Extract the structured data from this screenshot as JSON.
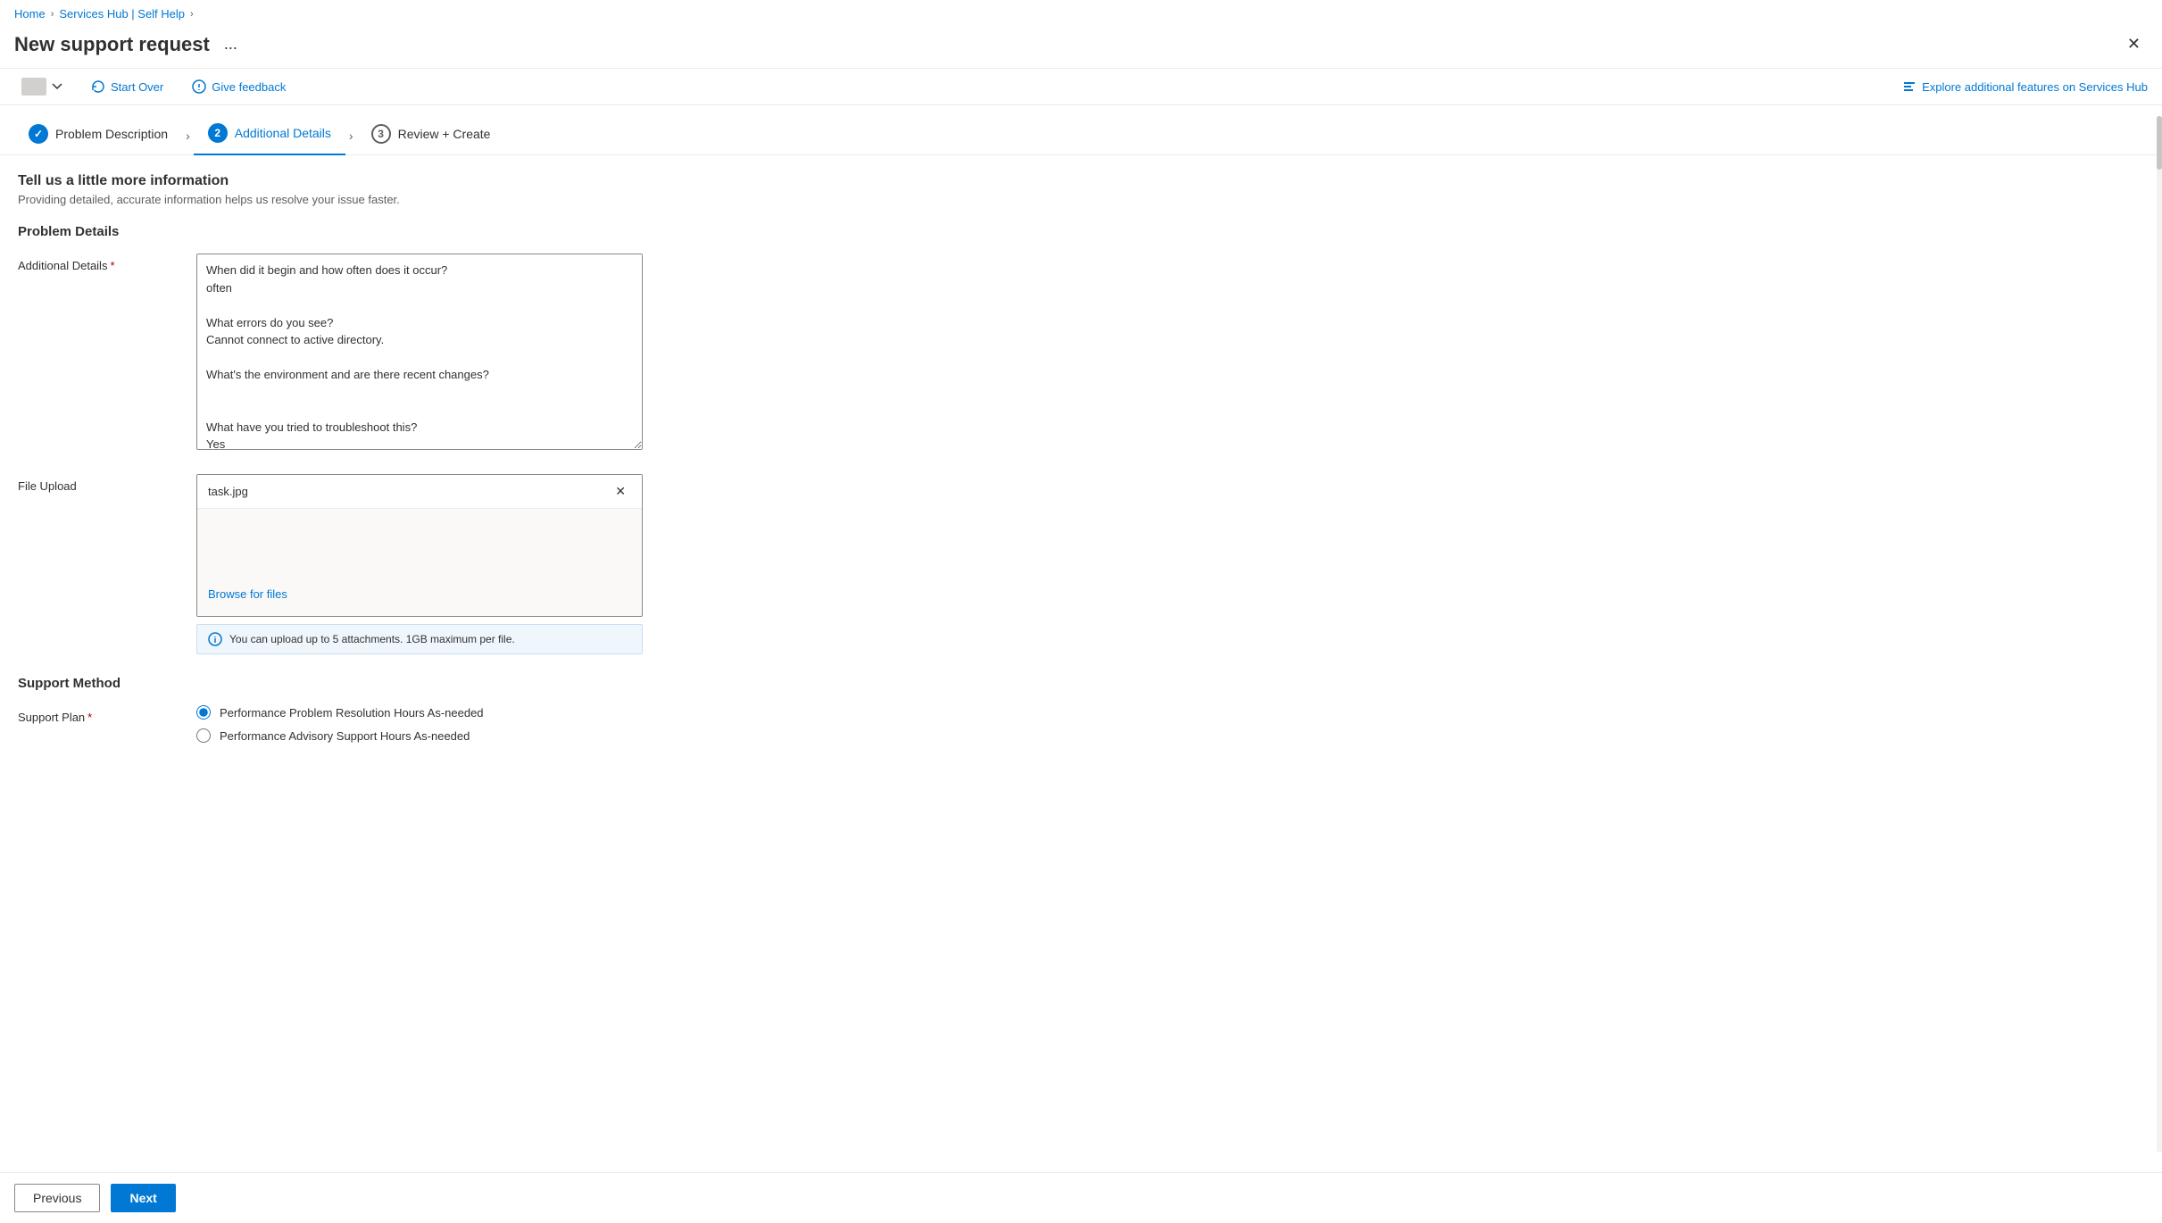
{
  "breadcrumb": {
    "home": "Home",
    "hub": "Services Hub | Self Help"
  },
  "title": "New support request",
  "ellipsis": "...",
  "toolbar": {
    "dropdown_label": "",
    "start_over": "Start Over",
    "give_feedback": "Give feedback",
    "explore": "Explore additional features on Services Hub"
  },
  "steps": [
    {
      "id": 1,
      "label": "Problem Description",
      "state": "completed"
    },
    {
      "id": 2,
      "label": "Additional Details",
      "state": "active"
    },
    {
      "id": 3,
      "label": "Review + Create",
      "state": "pending"
    }
  ],
  "section": {
    "title": "Tell us a little more information",
    "subtitle": "Providing detailed, accurate information helps us resolve your issue faster."
  },
  "problem_details": {
    "title": "Problem Details",
    "additional_details_label": "Additional Details",
    "textarea_content": "When did it begin and how often does it occur?\noften\n\nWhat errors do you see?\nCannot connect to active directory.\n\nWhat's the environment and are there recent changes?\n\n\nWhat have you tried to troubleshoot this?\nYes",
    "file_upload_label": "File Upload",
    "file_name": "task.jpg",
    "browse_label": "Browse for files",
    "upload_info": "You can upload up to 5 attachments. 1GB maximum per file."
  },
  "support_method": {
    "section_title": "Support Method",
    "plan_label": "Support Plan",
    "options": [
      {
        "id": "opt1",
        "label": "Performance Problem Resolution Hours As-needed",
        "selected": true
      },
      {
        "id": "opt2",
        "label": "Performance Advisory Support Hours As-needed",
        "selected": false
      }
    ]
  },
  "nav": {
    "previous": "Previous",
    "next": "Next"
  }
}
